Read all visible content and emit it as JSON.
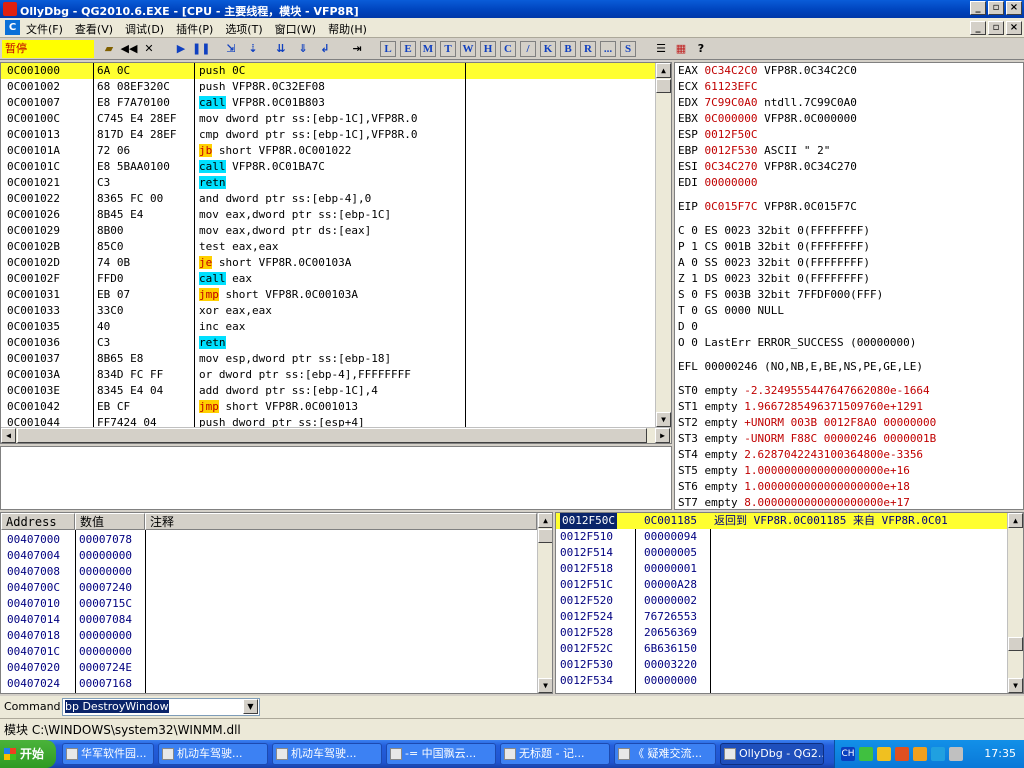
{
  "window": {
    "title": "OllyDbg - QG2010.6.EXE - [CPU - 主要线程，模块 - VFP8R]"
  },
  "menu": [
    "文件(F)",
    "查看(V)",
    "调试(D)",
    "插件(P)",
    "选项(T)",
    "窗口(W)",
    "帮助(H)"
  ],
  "toolbar": {
    "status": "暂停",
    "letters": [
      "L",
      "E",
      "M",
      "T",
      "W",
      "H",
      "C",
      "/",
      "K",
      "B",
      "R",
      "...",
      "S"
    ]
  },
  "cpu": {
    "rows": [
      {
        "addr": "0C001000",
        "hex": "6A 0C",
        "dis": "push 0C",
        "kind": "sel"
      },
      {
        "addr": "0C001002",
        "hex": "68 08EF320C",
        "dis": "push VFP8R.0C32EF08",
        "kind": ""
      },
      {
        "addr": "0C001007",
        "hex": "E8 F7A70100",
        "dis": "call VFP8R.0C01B803",
        "kind": "call"
      },
      {
        "addr": "0C00100C",
        "hex": "C745 E4 28EF",
        "dis": "mov dword ptr ss:[ebp-1C],VFP8R.0",
        "kind": ""
      },
      {
        "addr": "0C001013",
        "hex": "817D E4 28EF",
        "dis": "cmp dword ptr ss:[ebp-1C],VFP8R.0",
        "kind": ""
      },
      {
        "addr": "0C00101A",
        "hex": "72 06",
        "dis": "jb short VFP8R.0C001022",
        "kind": "jcc"
      },
      {
        "addr": "0C00101C",
        "hex": "E8 5BAA0100",
        "dis": "call VFP8R.0C01BA7C",
        "kind": "call"
      },
      {
        "addr": "0C001021",
        "hex": "C3",
        "dis": "retn",
        "kind": "retn"
      },
      {
        "addr": "0C001022",
        "hex": "8365 FC 00",
        "dis": "and dword ptr ss:[ebp-4],0",
        "kind": ""
      },
      {
        "addr": "0C001026",
        "hex": "8B45 E4",
        "dis": "mov eax,dword ptr ss:[ebp-1C]",
        "kind": ""
      },
      {
        "addr": "0C001029",
        "hex": "8B00",
        "dis": "mov eax,dword ptr ds:[eax]",
        "kind": ""
      },
      {
        "addr": "0C00102B",
        "hex": "85C0",
        "dis": "test eax,eax",
        "kind": ""
      },
      {
        "addr": "0C00102D",
        "hex": "74 0B",
        "dis": "je short VFP8R.0C00103A",
        "kind": "jcc"
      },
      {
        "addr": "0C00102F",
        "hex": "FFD0",
        "dis": "call eax",
        "kind": "call"
      },
      {
        "addr": "0C001031",
        "hex": "EB 07",
        "dis": "jmp short VFP8R.0C00103A",
        "kind": "jmp"
      },
      {
        "addr": "0C001033",
        "hex": "33C0",
        "dis": "xor eax,eax",
        "kind": ""
      },
      {
        "addr": "0C001035",
        "hex": "40",
        "dis": "inc eax",
        "kind": ""
      },
      {
        "addr": "0C001036",
        "hex": "C3",
        "dis": "retn",
        "kind": "retn"
      },
      {
        "addr": "0C001037",
        "hex": "8B65 E8",
        "dis": "mov esp,dword ptr ss:[ebp-18]",
        "kind": ""
      },
      {
        "addr": "0C00103A",
        "hex": "834D FC FF",
        "dis": "or dword ptr ss:[ebp-4],FFFFFFFF",
        "kind": ""
      },
      {
        "addr": "0C00103E",
        "hex": "8345 E4 04",
        "dis": "add dword ptr ss:[ebp-1C],4",
        "kind": ""
      },
      {
        "addr": "0C001042",
        "hex": "EB CF",
        "dis": "jmp short VFP8R.0C001013",
        "kind": "jmp"
      },
      {
        "addr": "0C001044",
        "hex": "FF7424 04",
        "dis": "push dword ptr ss:[esp+4]",
        "kind": ""
      }
    ]
  },
  "registers": {
    "gp": [
      {
        "name": "EAX",
        "val": "0C34C2C0",
        "note": "VFP8R.0C34C2C0"
      },
      {
        "name": "ECX",
        "val": "61123EFC",
        "note": ""
      },
      {
        "name": "EDX",
        "val": "7C99C0A0",
        "note": "ntdll.7C99C0A0"
      },
      {
        "name": "EBX",
        "val": "0C000000",
        "note": "VFP8R.0C000000"
      },
      {
        "name": "ESP",
        "val": "0012F50C",
        "note": ""
      },
      {
        "name": "EBP",
        "val": "0012F530",
        "note": "ASCII \" 2\""
      },
      {
        "name": "ESI",
        "val": "0C34C270",
        "note": "VFP8R.0C34C270"
      },
      {
        "name": "EDI",
        "val": "00000000",
        "note": ""
      }
    ],
    "eip": {
      "name": "EIP",
      "val": "0C015F7C",
      "note": "VFP8R.0C015F7C"
    },
    "flags": [
      "C 0  ES 0023 32bit 0(FFFFFFFF)",
      "P 1  CS 001B 32bit 0(FFFFFFFF)",
      "A 0  SS 0023 32bit 0(FFFFFFFF)",
      "Z 1  DS 0023 32bit 0(FFFFFFFF)",
      "S 0  FS 003B 32bit 7FFDF000(FFF)",
      "T 0  GS 0000 NULL",
      "D 0",
      "O 0  LastErr ERROR_SUCCESS (00000000)"
    ],
    "efl": "EFL 00000246 (NO,NB,E,BE,NS,PE,GE,LE)",
    "fpu": [
      {
        "n": "ST0",
        "t": "empty",
        "v": "-2.3249555447647662080e-1664"
      },
      {
        "n": "ST1",
        "t": "empty",
        "v": "1.9667285496371509760e+1291"
      },
      {
        "n": "ST2",
        "t": "empty",
        "v": "+UNORM 003B 0012F8A0 00000000"
      },
      {
        "n": "ST3",
        "t": "empty",
        "v": "-UNORM F88C 00000246 0000001B"
      },
      {
        "n": "ST4",
        "t": "empty",
        "v": "2.6287042243100364800e-3356"
      },
      {
        "n": "ST5",
        "t": "empty",
        "v": "1.0000000000000000000e+16"
      },
      {
        "n": "ST6",
        "t": "empty",
        "v": "1.0000000000000000000e+18"
      },
      {
        "n": "ST7",
        "t": "empty",
        "v": "8.0000000000000000000e+17"
      }
    ]
  },
  "dump": {
    "headers": [
      "Address",
      "数值",
      "注释"
    ],
    "rows": [
      [
        "00407000",
        "00007078"
      ],
      [
        "00407004",
        "00000000"
      ],
      [
        "00407008",
        "00000000"
      ],
      [
        "0040700C",
        "00007240"
      ],
      [
        "00407010",
        "0000715C"
      ],
      [
        "00407014",
        "00007084"
      ],
      [
        "00407018",
        "00000000"
      ],
      [
        "0040701C",
        "00000000"
      ],
      [
        "00407020",
        "0000724E"
      ],
      [
        "00407024",
        "00007168"
      ]
    ]
  },
  "stack": {
    "rows": [
      {
        "a": "0012F50C",
        "v": "0C001185",
        "c": "返回到 VFP8R.0C001185 来自 VFP8R.0C01",
        "sel": true
      },
      {
        "a": "0012F510",
        "v": "00000094",
        "c": ""
      },
      {
        "a": "0012F514",
        "v": "00000005",
        "c": ""
      },
      {
        "a": "0012F518",
        "v": "00000001",
        "c": ""
      },
      {
        "a": "0012F51C",
        "v": "00000A28",
        "c": ""
      },
      {
        "a": "0012F520",
        "v": "00000002",
        "c": ""
      },
      {
        "a": "0012F524",
        "v": "76726553",
        "c": ""
      },
      {
        "a": "0012F528",
        "v": "20656369",
        "c": ""
      },
      {
        "a": "0012F52C",
        "v": "6B636150",
        "c": ""
      },
      {
        "a": "0012F530",
        "v": "00003220",
        "c": ""
      },
      {
        "a": "0012F534",
        "v": "00000000",
        "c": ""
      }
    ]
  },
  "command": {
    "label": "Command :",
    "value": "bp DestroyWindow"
  },
  "module": "模块 C:\\WINDOWS\\system32\\WINMM.dll",
  "taskbar": {
    "start": "开始",
    "tasks": [
      "华军软件园...",
      "机动车驾驶...",
      "机动车驾驶...",
      "-= 中国飘云...",
      "无标题 - 记...",
      "《 疑难交流...",
      "OllyDbg - QG2..."
    ],
    "clock": "17:35",
    "tray_lang": "CH"
  }
}
